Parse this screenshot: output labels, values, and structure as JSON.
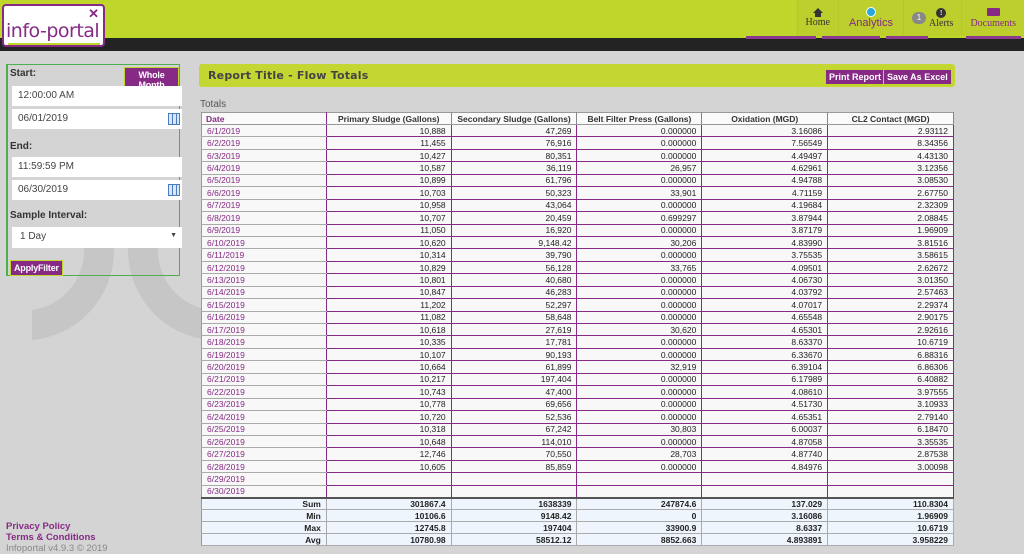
{
  "header": {
    "logo_text": "info-portal",
    "nav": [
      {
        "label": "Home",
        "icon": "home-icon"
      },
      {
        "label": "Analytics",
        "icon": "analytics-icon"
      },
      {
        "label": "Alerts",
        "icon": "alert-icon",
        "badge": "1"
      },
      {
        "label": "Documents",
        "icon": "folder-icon"
      }
    ]
  },
  "filter": {
    "start_label": "Start:",
    "whole_month_label": "Whole Month",
    "start_time": "12:00:00 AM",
    "start_date": "06/01/2019",
    "end_label": "End:",
    "end_time": "11:59:59 PM",
    "end_date": "06/30/2019",
    "interval_label": "Sample Interval:",
    "interval_value": "1 Day",
    "apply_label": "ApplyFilter"
  },
  "footer": {
    "privacy": "Privacy Policy",
    "terms": "Terms & Conditions",
    "version": "Infoportal v4.9.3 © 2019"
  },
  "report": {
    "title": "Report Title - Flow Totals",
    "print_label": "Print Report",
    "excel_label": "Save As Excel",
    "section_label": "Totals",
    "columns": [
      "Date",
      "Primary Sludge (Gallons)",
      "Secondary Sludge (Gallons)",
      "Belt Filter Press (Gallons)",
      "Oxidation (MGD)",
      "CL2 Contact (MGD)"
    ],
    "rows": [
      [
        "6/1/2019",
        "10,888",
        "47,269",
        "0.000000",
        "3.16086",
        "2.93112"
      ],
      [
        "6/2/2019",
        "11,455",
        "76,916",
        "0.000000",
        "7.56549",
        "8.34356"
      ],
      [
        "6/3/2019",
        "10,427",
        "80,351",
        "0.000000",
        "4.49497",
        "4.43130"
      ],
      [
        "6/4/2019",
        "10,587",
        "36,119",
        "26,957",
        "4.62961",
        "3.12356"
      ],
      [
        "6/5/2019",
        "10,899",
        "61,796",
        "0.000000",
        "4.94788",
        "3.08530"
      ],
      [
        "6/6/2019",
        "10,703",
        "50,323",
        "33,901",
        "4.71159",
        "2.67750"
      ],
      [
        "6/7/2019",
        "10,958",
        "43,064",
        "0.000000",
        "4.19684",
        "2.32309"
      ],
      [
        "6/8/2019",
        "10,707",
        "20,459",
        "0.699297",
        "3.87944",
        "2.08845"
      ],
      [
        "6/9/2019",
        "11,050",
        "16,920",
        "0.000000",
        "3.87179",
        "1.96909"
      ],
      [
        "6/10/2019",
        "10,620",
        "9,148.42",
        "30,206",
        "4.83990",
        "3.81516"
      ],
      [
        "6/11/2019",
        "10,314",
        "39,790",
        "0.000000",
        "3.75535",
        "3.58615"
      ],
      [
        "6/12/2019",
        "10,829",
        "56,128",
        "33,765",
        "4.09501",
        "2.62672"
      ],
      [
        "6/13/2019",
        "10,801",
        "40,680",
        "0.000000",
        "4.06730",
        "3.01350"
      ],
      [
        "6/14/2019",
        "10,847",
        "46,283",
        "0.000000",
        "4.03792",
        "2.57463"
      ],
      [
        "6/15/2019",
        "11,202",
        "52,297",
        "0.000000",
        "4.07017",
        "2.29374"
      ],
      [
        "6/16/2019",
        "11,082",
        "58,648",
        "0.000000",
        "4.65548",
        "2.90175"
      ],
      [
        "6/17/2019",
        "10,618",
        "27,619",
        "30,620",
        "4.65301",
        "2.92616"
      ],
      [
        "6/18/2019",
        "10,335",
        "17,781",
        "0.000000",
        "8.63370",
        "10.6719"
      ],
      [
        "6/19/2019",
        "10,107",
        "90,193",
        "0.000000",
        "6.33670",
        "6.88316"
      ],
      [
        "6/20/2019",
        "10,664",
        "61,899",
        "32,919",
        "6.39104",
        "6.86306"
      ],
      [
        "6/21/2019",
        "10,217",
        "197,404",
        "0.000000",
        "6.17989",
        "6.40882"
      ],
      [
        "6/22/2019",
        "10,743",
        "47,400",
        "0.000000",
        "4.08610",
        "3.97555"
      ],
      [
        "6/23/2019",
        "10,778",
        "69,656",
        "0.000000",
        "4.51730",
        "3.10933"
      ],
      [
        "6/24/2019",
        "10,720",
        "52,536",
        "0.000000",
        "4.65351",
        "2.79140"
      ],
      [
        "6/25/2019",
        "10,318",
        "67,242",
        "30,803",
        "6.00037",
        "6.18470"
      ],
      [
        "6/26/2019",
        "10,648",
        "114,010",
        "0.000000",
        "4.87058",
        "3.35535"
      ],
      [
        "6/27/2019",
        "12,746",
        "70,550",
        "28,703",
        "4.87740",
        "2.87538"
      ],
      [
        "6/28/2019",
        "10,605",
        "85,859",
        "0.000000",
        "4.84976",
        "3.00098"
      ],
      [
        "6/29/2019",
        "",
        "",
        "",
        "",
        ""
      ],
      [
        "6/30/2019",
        "",
        "",
        "",
        "",
        ""
      ]
    ],
    "stats": [
      [
        "Sum",
        "301867.4",
        "1638339",
        "247874.6",
        "137.029",
        "110.8304"
      ],
      [
        "Min",
        "10106.6",
        "9148.42",
        "0",
        "3.16086",
        "1.96909"
      ],
      [
        "Max",
        "12745.8",
        "197404",
        "33900.9",
        "8.6337",
        "10.6719"
      ],
      [
        "Avg",
        "10780.98",
        "58512.12",
        "8852.663",
        "4.893891",
        "3.958229"
      ]
    ]
  }
}
